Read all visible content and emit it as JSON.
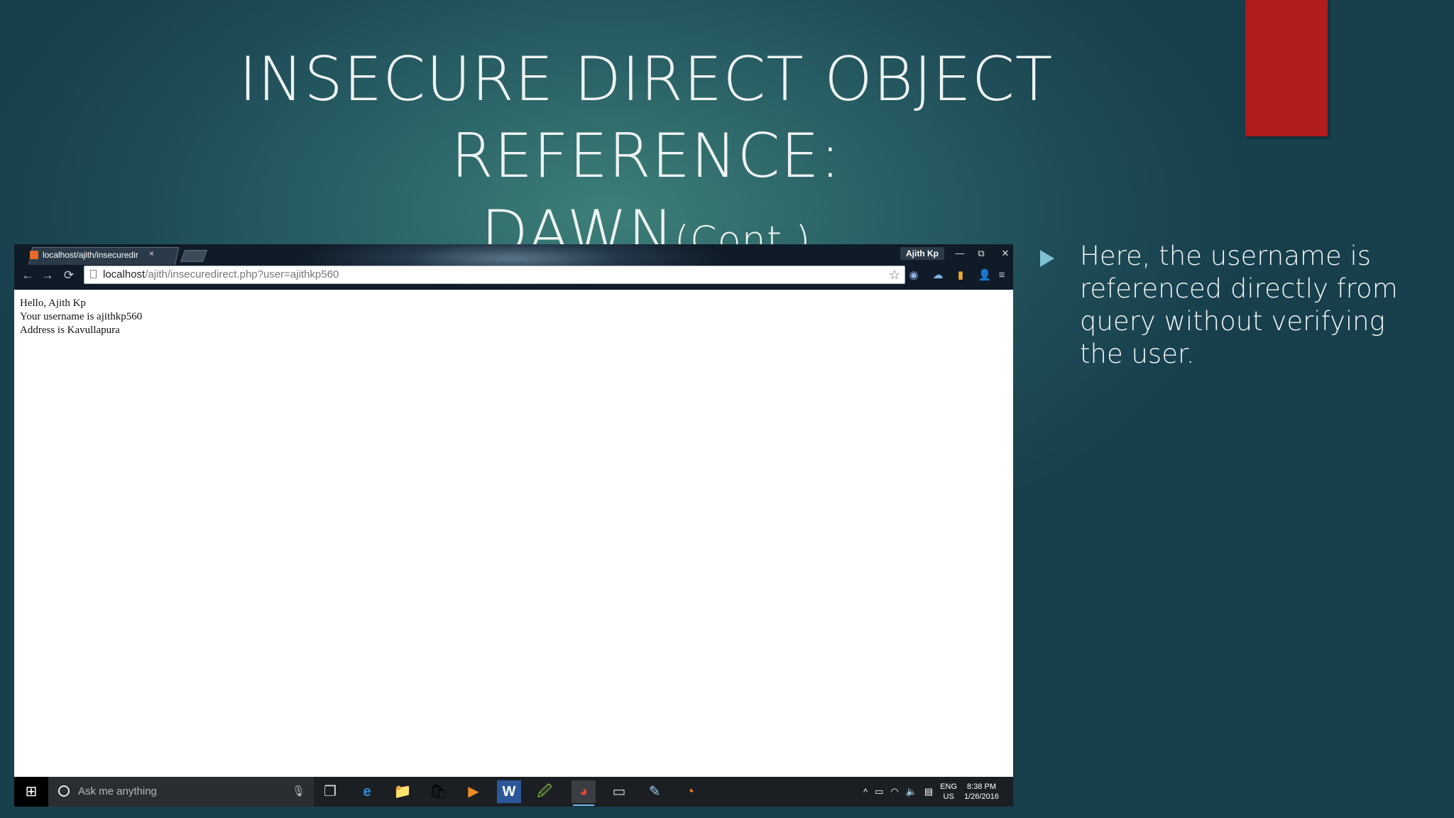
{
  "slide": {
    "title_line1": "INSECURE DIRECT OBJECT REFERENCE:",
    "title_line2_main": "DAWN",
    "title_line2_small": "(Cont.)",
    "bullet": "Here, the username is referenced directly from query without verifying the user.",
    "accent_color": "#b11c1c",
    "bullet_color": "#7fc0d4"
  },
  "browser": {
    "tab_title": "localhost/ajith/insecuredir",
    "tab_close": "×",
    "profile_name": "Ajith Kp",
    "window_buttons": {
      "minimize": "—",
      "restore": "⧉",
      "close": "✕"
    },
    "nav": {
      "back": "←",
      "forward": "→",
      "reload": "⟳"
    },
    "url_host": "localhost",
    "url_path": "/ajith/insecuredirect.php?user=ajithkp560",
    "star": "☆",
    "extensions": [
      "◉",
      "☁",
      "▮",
      "👤",
      "≡"
    ]
  },
  "page": {
    "lines": [
      "Hello, Ajith Kp",
      "Your username is ajithkp560",
      "Address is Kavullapura"
    ]
  },
  "taskbar": {
    "start": "⊞",
    "search_placeholder": "Ask me anything",
    "mic": "🎙",
    "task_view": "❐",
    "apps": [
      "e",
      "📁",
      "🛍",
      "▶",
      "W",
      "🖉",
      "◕",
      "▭",
      "✎",
      "◔"
    ],
    "tray_up": "^",
    "tray_battery": "▭",
    "tray_wifi": "◠",
    "tray_volume": "🔈",
    "tray_message": "▤",
    "lang_top": "ENG",
    "lang_bottom": "US",
    "time": "8:38 PM",
    "date": "1/26/2016"
  }
}
